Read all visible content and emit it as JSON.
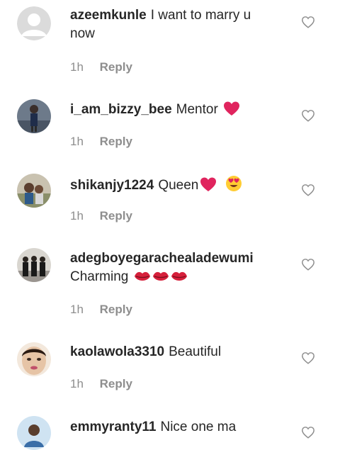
{
  "comments": [
    {
      "username": "azeemkunle",
      "text": "I want to marry u",
      "text2": "now",
      "time": "1h",
      "reply": "Reply"
    },
    {
      "username": "i_am_bizzy_bee",
      "text": "Mentor",
      "time": "1h",
      "reply": "Reply",
      "emojis": [
        "red-heart-emoji"
      ]
    },
    {
      "username": "shikanjy1224",
      "text": "Queen",
      "time": "1h",
      "reply": "Reply",
      "emojis": [
        "red-heart-emoji",
        "heart-eyes-emoji"
      ]
    },
    {
      "username": "adegboyegarachealadewumi",
      "text": "Charming",
      "time": "1h",
      "reply": "Reply",
      "emojis": [
        "kiss-lips-emoji",
        "kiss-lips-emoji",
        "kiss-lips-emoji"
      ]
    },
    {
      "username": "kaolawola3310",
      "text": "Beautiful",
      "time": "1h",
      "reply": "Reply"
    },
    {
      "username": "emmyranty11",
      "text": "Nice one ma"
    }
  ],
  "icons": {
    "like": "heart-outline-icon"
  },
  "colors": {
    "text": "#262626",
    "meta": "#8e8e8e",
    "heart_emoji": "#e0245e"
  }
}
